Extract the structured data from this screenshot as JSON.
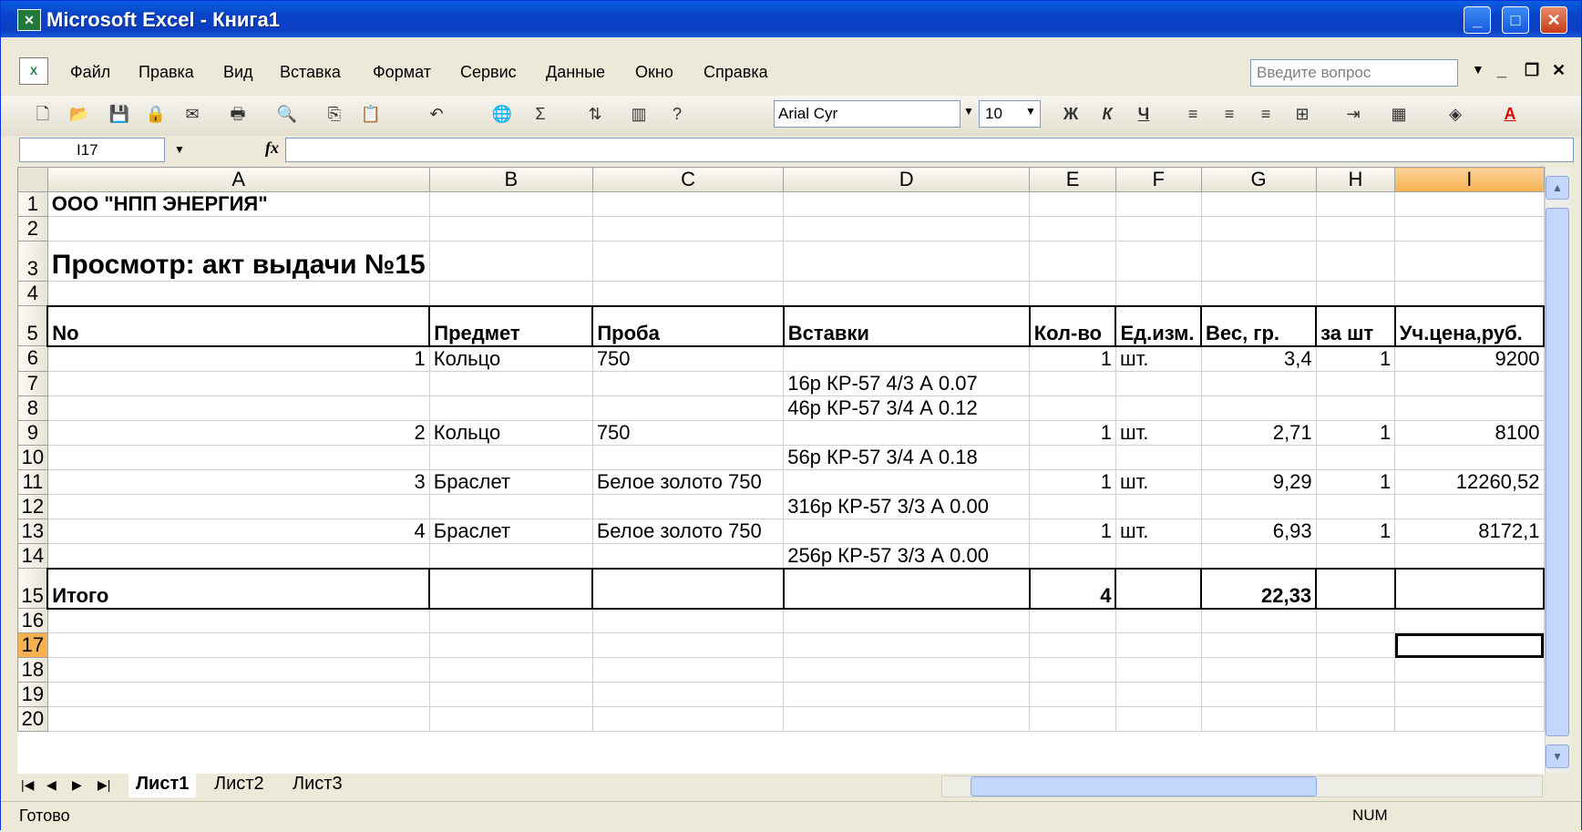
{
  "window": {
    "title": "Microsoft Excel - Книга1"
  },
  "menu": [
    "Файл",
    "Правка",
    "Вид",
    "Вставка",
    "Формат",
    "Сервис",
    "Данные",
    "Окно",
    "Справка"
  ],
  "help": {
    "placeholder": "Введите вопрос"
  },
  "format": {
    "font": "Arial Cyr",
    "size": "10",
    "bold": "Ж",
    "italic": "К",
    "underline": "Ч"
  },
  "formula": {
    "cell_ref": "I17",
    "fx": "fx",
    "value": ""
  },
  "columns": [
    "A",
    "B",
    "C",
    "D",
    "E",
    "F",
    "G",
    "H",
    "I"
  ],
  "rows": [
    {
      "n": "1",
      "cells": [
        "ООО \"НПП ЭНЕРГИЯ\"",
        "",
        "",
        "",
        "",
        "",
        "",
        "",
        ""
      ]
    },
    {
      "n": "2",
      "cells": [
        "",
        "",
        "",
        "",
        "",
        "",
        "",
        "",
        ""
      ]
    },
    {
      "n": "3",
      "cells": [
        "Просмотр: акт выдачи №15",
        "",
        "",
        "",
        "",
        "",
        "",
        "",
        ""
      ]
    },
    {
      "n": "4",
      "cells": [
        "",
        "",
        "",
        "",
        "",
        "",
        "",
        "",
        ""
      ]
    },
    {
      "n": "5",
      "cells": [
        "No",
        "Предмет",
        "Проба",
        "Вставки",
        "Кол-во",
        "Ед.изм.",
        "Вес, гр.",
        "за шт",
        "Уч.цена,руб."
      ]
    },
    {
      "n": "6",
      "cells": [
        "1",
        "Кольцо",
        "750",
        "",
        "1",
        "шт.",
        "3,4",
        "1",
        "9200"
      ]
    },
    {
      "n": "7",
      "cells": [
        "",
        "",
        "",
        "16р КР-57 4/3 А 0.07",
        "",
        "",
        "",
        "",
        ""
      ]
    },
    {
      "n": "8",
      "cells": [
        "",
        "",
        "",
        "46р КР-57 3/4 А 0.12",
        "",
        "",
        "",
        "",
        ""
      ]
    },
    {
      "n": "9",
      "cells": [
        "2",
        "Кольцо",
        "750",
        "",
        "1",
        "шт.",
        "2,71",
        "1",
        "8100"
      ]
    },
    {
      "n": "10",
      "cells": [
        "",
        "",
        "",
        "56р КР-57 3/4 А 0.18",
        "",
        "",
        "",
        "",
        ""
      ]
    },
    {
      "n": "11",
      "cells": [
        "3",
        "Браслет",
        "Белое золото 750",
        "",
        "1",
        "шт.",
        "9,29",
        "1",
        "12260,52"
      ]
    },
    {
      "n": "12",
      "cells": [
        "",
        "",
        "",
        "316р КР-57 3/3 А 0.00",
        "",
        "",
        "",
        "",
        ""
      ]
    },
    {
      "n": "13",
      "cells": [
        "4",
        "Браслет",
        "Белое золото 750",
        "",
        "1",
        "шт.",
        "6,93",
        "1",
        "8172,1"
      ]
    },
    {
      "n": "14",
      "cells": [
        "",
        "",
        "",
        "256р КР-57 3/3 А 0.00",
        "",
        "",
        "",
        "",
        ""
      ]
    },
    {
      "n": "15",
      "cells": [
        "Итого",
        "",
        "",
        "",
        "4",
        "",
        "22,33",
        "",
        ""
      ]
    },
    {
      "n": "16",
      "cells": [
        "",
        "",
        "",
        "",
        "",
        "",
        "",
        "",
        ""
      ]
    },
    {
      "n": "17",
      "cells": [
        "",
        "",
        "",
        "",
        "",
        "",
        "",
        "",
        ""
      ]
    },
    {
      "n": "18",
      "cells": [
        "",
        "",
        "",
        "",
        "",
        "",
        "",
        "",
        ""
      ]
    },
    {
      "n": "19",
      "cells": [
        "",
        "",
        "",
        "",
        "",
        "",
        "",
        "",
        ""
      ]
    },
    {
      "n": "20",
      "cells": [
        "",
        "",
        "",
        "",
        "",
        "",
        "",
        "",
        ""
      ]
    }
  ],
  "sheets": [
    "Лист1",
    "Лист2",
    "Лист3"
  ],
  "status": {
    "left": "Готово",
    "num": "NUM"
  }
}
